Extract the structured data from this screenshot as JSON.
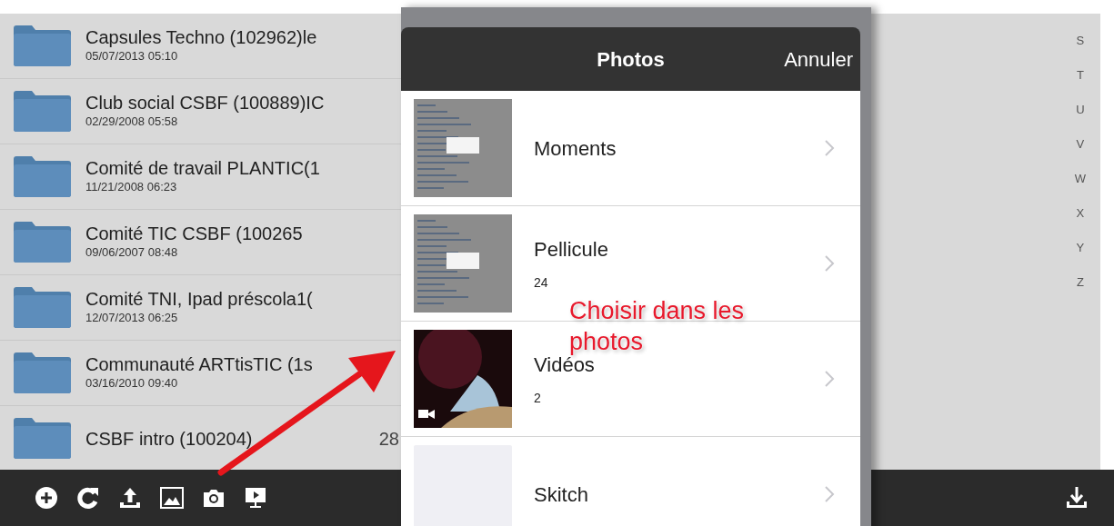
{
  "folders": [
    {
      "title": "Capsules Techno (102962)le",
      "date": "05/07/2013 05:10"
    },
    {
      "title": "Club social CSBF (100889)IC",
      "date": "02/29/2008 05:58"
    },
    {
      "title": "Comité de travail PLANTIC(1",
      "date": "11/21/2008 06:23"
    },
    {
      "title": "Comité TIC CSBF (100265",
      "date": "09/06/2007 08:48"
    },
    {
      "title": "Comité TNI, Ipad préscola1(",
      "date": "12/07/2013 06:25"
    },
    {
      "title": "Communauté ARTtisTIC (1s",
      "date": "03/16/2010 09:40"
    },
    {
      "title": "CSBF intro (100204)",
      "tail": "28"
    }
  ],
  "index_letters": [
    "S",
    "T",
    "U",
    "V",
    "W",
    "X",
    "Y",
    "Z"
  ],
  "toolbar": [
    {
      "kind": "add"
    },
    {
      "kind": "refresh"
    },
    {
      "kind": "upload"
    },
    {
      "kind": "image"
    },
    {
      "kind": "camera"
    },
    {
      "kind": "present"
    }
  ],
  "toolbar_right": [
    {
      "kind": "download"
    }
  ],
  "popover": {
    "title": "Photos",
    "cancel": "Annuler",
    "albums": [
      {
        "name": "Moments",
        "kind": "screenshot"
      },
      {
        "name": "Pellicule",
        "count": "24",
        "kind": "screenshot"
      },
      {
        "name": "Vidéos",
        "count": "2",
        "kind": "video"
      },
      {
        "name": "Skitch",
        "kind": "blank"
      }
    ]
  },
  "annotation": {
    "text": "Choisir dans les photos"
  }
}
